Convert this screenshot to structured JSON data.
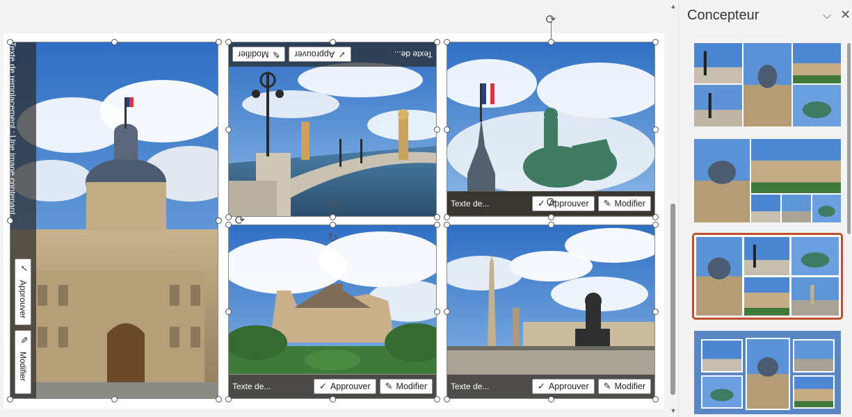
{
  "photo_labels": {
    "alt_text_short": "Texte de...",
    "approve": "Approuver",
    "modify": "Modifier",
    "alt_text_long": "Texte de remplacement : Une image contenant..."
  },
  "designer_pane": {
    "title": "Concepteur",
    "selected_design_index": 2,
    "accent_color": "#c0502b",
    "focus_color": "#5a86c4"
  },
  "icons": {
    "checkmark": "checkmark-icon",
    "pencil": "pencil-icon",
    "rotate": "rotate-icon",
    "chevron": "chevron-down-icon",
    "close": "close-icon"
  }
}
